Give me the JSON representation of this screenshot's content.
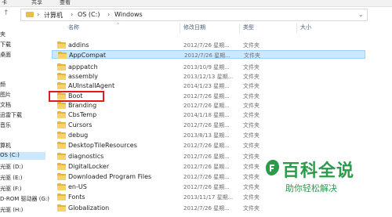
{
  "toolbar": {
    "left_fragment": "卡",
    "mid_fragment_1": "共享",
    "mid_fragment_2": "查看"
  },
  "address_bar": {
    "segments": [
      "计算机",
      "OS (C:)",
      "Windows"
    ],
    "separator": "›"
  },
  "columns": {
    "name": "名称",
    "date": "修改日期",
    "type": "类型",
    "size": "大小"
  },
  "nav_pane": {
    "items": [
      "夹",
      "下载",
      "桌面",
      "",
      "频",
      "图片",
      "文档",
      "迅雷下载",
      "音乐",
      "",
      "算机",
      "OS (C:)",
      "光驱 (D:)",
      "光驱 (E:)",
      "光驱 (F:)",
      "D-ROM 驱动器 (G:)",
      "光驱 (H:)"
    ]
  },
  "files": [
    {
      "name": "addins",
      "date": "2012/7/26 星期...",
      "type": "文件夹"
    },
    {
      "name": "AppCompat",
      "date": "2012/7/26 星期...",
      "type": "文件夹"
    },
    {
      "name": "apppatch",
      "date": "2013/10/9 星期...",
      "type": "文件夹"
    },
    {
      "name": "assembly",
      "date": "2013/12/13 星期...",
      "type": "文件夹"
    },
    {
      "name": "AUInstallAgent",
      "date": "2014/1/23 星期...",
      "type": "文件夹"
    },
    {
      "name": "Boot",
      "date": "2012/7/26 星期...",
      "type": "文件夹"
    },
    {
      "name": "Branding",
      "date": "2012/7/26 星期...",
      "type": "文件夹"
    },
    {
      "name": "CbsTemp",
      "date": "2014/1/18 星期...",
      "type": "文件夹"
    },
    {
      "name": "Cursors",
      "date": "2012/7/26 星期...",
      "type": "文件夹"
    },
    {
      "name": "debug",
      "date": "2013/8/13 星期...",
      "type": "文件夹"
    },
    {
      "name": "DesktopTileResources",
      "date": "2012/7/26 星期...",
      "type": "文件夹"
    },
    {
      "name": "diagnostics",
      "date": "2012/7/26 星期...",
      "type": "文件夹"
    },
    {
      "name": "DigitalLocker",
      "date": "2012/7/26 星期...",
      "type": "文件夹"
    },
    {
      "name": "Downloaded Program Files",
      "date": "2012/7/26 星期...",
      "type": "文件夹"
    },
    {
      "name": "en-US",
      "date": "2012/7/26 星期...",
      "type": "文件夹"
    },
    {
      "name": "Fonts",
      "date": "2013/11/17 星期...",
      "type": "文件夹"
    },
    {
      "name": "Globalization",
      "date": "2012/7/26 星期...",
      "type": "文件夹"
    }
  ],
  "watermark": {
    "title": "百科全说",
    "subtitle": "助你轻松解决"
  },
  "colors": {
    "selection": "#cce8ff",
    "highlight_box": "#e01b1b",
    "folder": "#e3b43f",
    "watermark": "#2b9a4b"
  }
}
